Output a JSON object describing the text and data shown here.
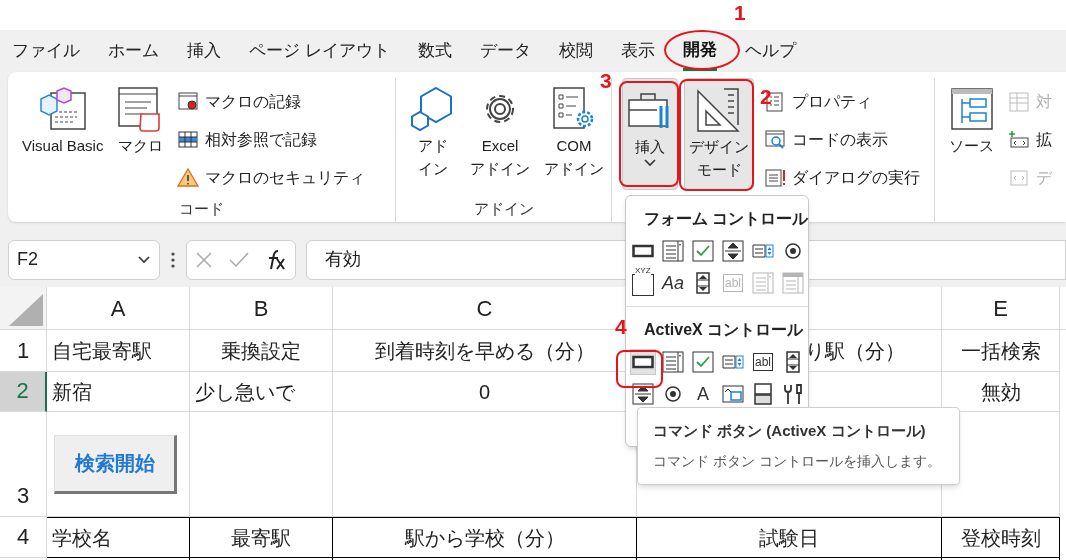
{
  "menu_tabs": [
    {
      "label": "ファイル",
      "selected": false
    },
    {
      "label": "ホーム",
      "selected": false
    },
    {
      "label": "挿入",
      "selected": false
    },
    {
      "label": "ページ レイアウト",
      "selected": false
    },
    {
      "label": "数式",
      "selected": false
    },
    {
      "label": "データ",
      "selected": false
    },
    {
      "label": "校閲",
      "selected": false
    },
    {
      "label": "表示",
      "selected": false
    },
    {
      "label": "開発",
      "selected": true
    },
    {
      "label": "ヘルプ",
      "selected": false
    }
  ],
  "ribbon": {
    "groups": [
      {
        "label": "コード",
        "large": [
          {
            "kind": "vba",
            "lines": [
              "Visual Basic"
            ],
            "pressed": false
          },
          {
            "kind": "macro",
            "lines": [
              "マクロ"
            ],
            "pressed": false
          }
        ],
        "small": [
          {
            "kind": "record",
            "label": "マクロの記録",
            "disabled": false
          },
          {
            "kind": "relative",
            "label": "相対参照で記録",
            "disabled": false
          },
          {
            "kind": "security",
            "label": "マクロのセキュリティ",
            "disabled": false
          }
        ]
      },
      {
        "label": "アドイン",
        "large": [
          {
            "kind": "addin",
            "lines": [
              "アド",
              "イン"
            ],
            "pressed": false
          },
          {
            "kind": "gear",
            "lines": [
              "Excel",
              "アドイン"
            ],
            "pressed": false
          },
          {
            "kind": "com",
            "lines": [
              "COM",
              "アドイン"
            ],
            "pressed": false
          }
        ]
      },
      {
        "large": [
          {
            "kind": "toolbox",
            "lines": [
              "挿入"
            ],
            "pressed": true,
            "dropdown": true
          },
          {
            "kind": "design",
            "lines": [
              "デザイン",
              "モード"
            ],
            "pressed": true
          }
        ],
        "small": [
          {
            "kind": "properties",
            "label": "プロパティ",
            "disabled": false
          },
          {
            "kind": "viewcode",
            "label": "コードの表示",
            "disabled": false
          },
          {
            "kind": "dialog",
            "label": "ダイアログの実行",
            "disabled": false
          }
        ]
      },
      {
        "large": [
          {
            "kind": "source",
            "lines": [
              "ソース"
            ],
            "pressed": false
          }
        ],
        "small": [
          {
            "kind": "map",
            "label": "対",
            "disabled": true
          },
          {
            "kind": "expand",
            "label": "拡",
            "disabled": false
          },
          {
            "kind": "export",
            "label": "デ",
            "disabled": true
          }
        ]
      }
    ]
  },
  "formula_bar": {
    "name_box": "F2",
    "value": "有効"
  },
  "sheet": {
    "columns": [
      {
        "label": "A"
      },
      {
        "label": "B"
      },
      {
        "label": "C"
      },
      {},
      {
        "label": "E"
      }
    ],
    "rows": [
      {
        "label": "1",
        "selected": false,
        "cells": [
          {
            "text": "自宅最寄駅"
          },
          {
            "text": "乗換設定"
          },
          {
            "text": "到着時刻を早める（分）"
          },
          {
            "text": "り駅（分）"
          },
          {
            "text": "一括検索"
          }
        ]
      },
      {
        "label": "2",
        "selected": true,
        "cells": [
          {
            "text": "新宿"
          },
          {
            "text": "少し急いで"
          },
          {
            "text": "0"
          },
          {},
          {
            "text": "無効"
          }
        ]
      },
      {
        "label": "3",
        "selected": false,
        "cells": [
          {
            "kind": "button",
            "text": "検索開始"
          },
          {},
          {},
          {},
          {}
        ]
      },
      {
        "label": "4",
        "selected": false,
        "kind": "table_header",
        "cells": [
          {
            "text": "学校名"
          },
          {
            "text": "最寄駅"
          },
          {
            "text": "駅から学校（分）"
          },
          {
            "text": "試験日"
          },
          {
            "text": "登校時刻"
          }
        ]
      }
    ]
  },
  "controls_menu": {
    "sections": [
      {
        "title": "フォーム コントロール",
        "items": [
          {
            "kind": "button",
            "disabled": false,
            "highlighted": false
          },
          {
            "kind": "list",
            "disabled": false,
            "highlighted": false
          },
          {
            "kind": "check",
            "disabled": false,
            "highlighted": false
          },
          {
            "kind": "spin",
            "disabled": false,
            "highlighted": false
          },
          {
            "kind": "combolist",
            "disabled": false,
            "highlighted": false
          },
          {
            "kind": "option",
            "disabled": false,
            "highlighted": false
          },
          {
            "kind": "group",
            "glyph": "XYZ",
            "disabled": false,
            "highlighted": false
          },
          {
            "kind": "label",
            "glyph": "Aa",
            "disabled": false,
            "highlighted": false
          },
          {
            "kind": "scroll",
            "disabled": false,
            "highlighted": false
          },
          {
            "kind": "text",
            "glyph": "abl",
            "disabled": true,
            "highlighted": false
          },
          {
            "kind": "list",
            "disabled": true,
            "highlighted": false
          },
          {
            "kind": "dropdown",
            "disabled": true,
            "highlighted": false
          }
        ]
      },
      {
        "title": "ActiveX コントロール",
        "items": [
          {
            "kind": "button",
            "disabled": false,
            "highlighted": true
          },
          {
            "kind": "list",
            "disabled": false,
            "highlighted": false
          },
          {
            "kind": "check",
            "disabled": false,
            "highlighted": false
          },
          {
            "kind": "combolist",
            "disabled": false,
            "highlighted": false
          },
          {
            "kind": "text",
            "glyph": "abl",
            "disabled": false,
            "highlighted": false
          },
          {
            "kind": "scroll",
            "disabled": false,
            "highlighted": false
          },
          {
            "kind": "spin",
            "disabled": false,
            "highlighted": false
          },
          {
            "kind": "option",
            "disabled": false,
            "highlighted": false
          },
          {
            "kind": "label",
            "glyph": "A",
            "disabled": false,
            "highlighted": false
          },
          {
            "kind": "image",
            "disabled": false,
            "highlighted": false
          },
          {
            "kind": "toggle",
            "disabled": false,
            "highlighted": false
          },
          {
            "kind": "more",
            "disabled": false,
            "highlighted": false
          }
        ]
      }
    ]
  },
  "tooltip": {
    "title": "コマンド ボタン (ActiveX コントロール)",
    "description": "コマンド ボタン コントロールを挿入します。"
  },
  "annotations": [
    {
      "number": "1",
      "kind": "ellipse"
    },
    {
      "number": "2",
      "kind": "frame"
    },
    {
      "number": "3",
      "kind": "frame"
    },
    {
      "number": "4",
      "kind": "frame"
    }
  ]
}
